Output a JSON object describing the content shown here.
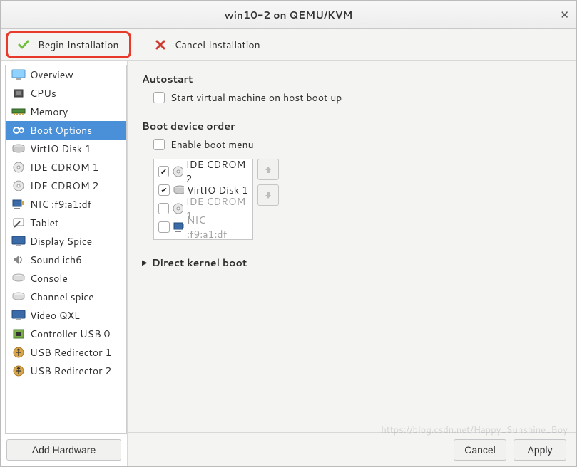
{
  "window": {
    "title": "win10-2 on QEMU/KVM"
  },
  "toolbar": {
    "begin_label": "Begin Installation",
    "cancel_label": "Cancel Installation"
  },
  "sidebar": {
    "add_hw_label": "Add Hardware",
    "items": [
      {
        "icon": "monitor",
        "label": "Overview"
      },
      {
        "icon": "cpu",
        "label": "CPUs"
      },
      {
        "icon": "memory",
        "label": "Memory"
      },
      {
        "icon": "gear",
        "label": "Boot Options",
        "selected": true
      },
      {
        "icon": "disk",
        "label": "VirtIO Disk 1"
      },
      {
        "icon": "cdrom",
        "label": "IDE CDROM 1"
      },
      {
        "icon": "cdrom",
        "label": "IDE CDROM 2"
      },
      {
        "icon": "nic",
        "label": "NIC :f9:a1:df"
      },
      {
        "icon": "tablet",
        "label": "Tablet"
      },
      {
        "icon": "display",
        "label": "Display Spice"
      },
      {
        "icon": "sound",
        "label": "Sound ich6"
      },
      {
        "icon": "serial",
        "label": "Console"
      },
      {
        "icon": "serial",
        "label": "Channel spice"
      },
      {
        "icon": "display",
        "label": "Video QXL"
      },
      {
        "icon": "usbctrl",
        "label": "Controller USB 0"
      },
      {
        "icon": "usb",
        "label": "USB Redirector 1"
      },
      {
        "icon": "usb",
        "label": "USB Redirector 2"
      }
    ]
  },
  "main": {
    "autostart": {
      "title": "Autostart",
      "checkbox_label": "Start virtual machine on host boot up",
      "checked": false
    },
    "boot_order": {
      "title": "Boot device order",
      "enable_menu_label": "Enable boot menu",
      "enable_menu_checked": false,
      "devices": [
        {
          "icon": "cdrom",
          "label": "IDE CDROM 2",
          "checked": true,
          "enabled": true
        },
        {
          "icon": "disk",
          "label": "VirtIO Disk 1",
          "checked": true,
          "enabled": true
        },
        {
          "icon": "cdrom",
          "label": "IDE CDROM 1",
          "checked": false,
          "enabled": false
        },
        {
          "icon": "nic",
          "label": "NIC :f9:a1:df",
          "checked": false,
          "enabled": false
        }
      ]
    },
    "direct_kernel": {
      "title": "Direct kernel boot",
      "expanded": false
    }
  },
  "footer": {
    "cancel_label": "Cancel",
    "apply_label": "Apply"
  },
  "watermark": "https://blog.csdn.net/Happy_Sunshine_Boy"
}
